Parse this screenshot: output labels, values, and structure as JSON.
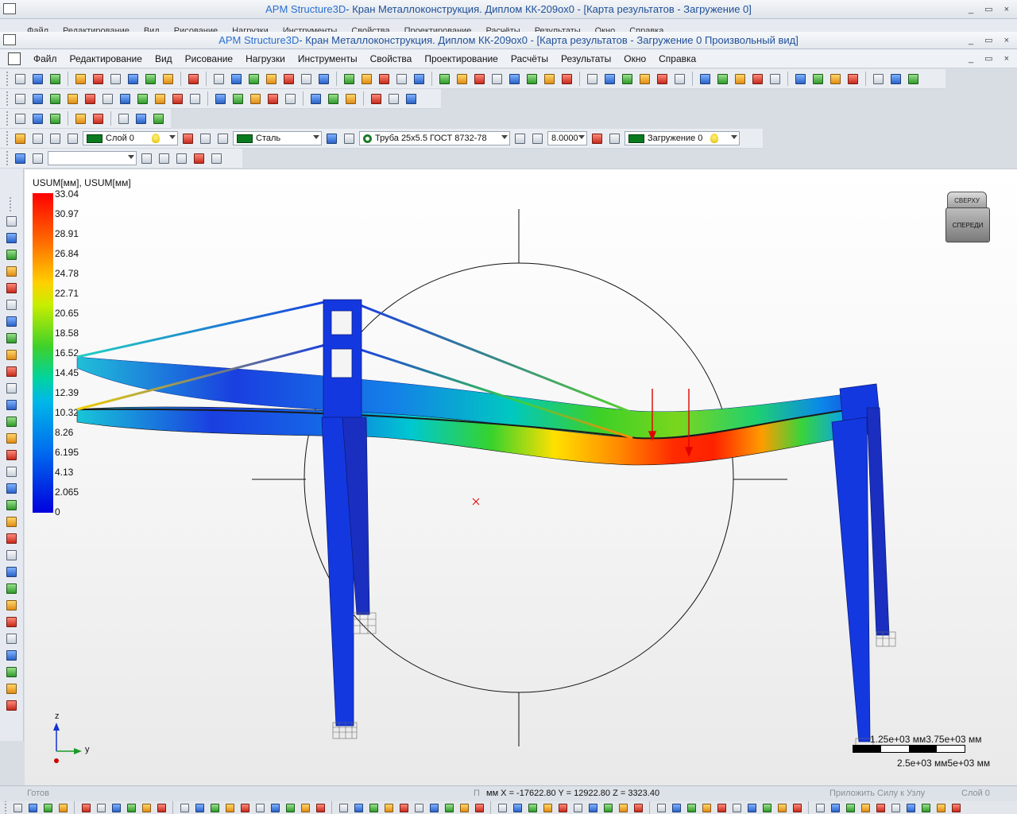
{
  "outer_window": {
    "app": "APM Structure3D",
    "title_rest": " - Кран Металлоконструкция. Диплом КК-209ох0 - [Карта результатов - Загружение 0]"
  },
  "inner_window": {
    "app": "APM Structure3D",
    "title_rest": " - Кран Металлоконструкция. Диплом КК-209ох0 - [Карта результатов - Загружение 0 Произвольный вид]"
  },
  "ghost_menu": [
    "Файл",
    "Редактирование",
    "Вид",
    "Рисование",
    "Нагрузки",
    "Инструменты",
    "Свойства",
    "Проектирование",
    "Расчёты",
    "Результаты",
    "Окно",
    "Справка"
  ],
  "menu": [
    "Файл",
    "Редактирование",
    "Вид",
    "Рисование",
    "Нагрузки",
    "Инструменты",
    "Свойства",
    "Проектирование",
    "Расчёты",
    "Результаты",
    "Окно",
    "Справка"
  ],
  "window_controls": {
    "minimize": "_",
    "restore": "▭",
    "close": "×"
  },
  "toolbar_props": {
    "layer": "Слой 0",
    "material": "Сталь",
    "section": "Труба  25x5.5 ГОСТ 8732-78",
    "angle": "8.0000",
    "load_case": "Загружение 0",
    "layer_color": "#0a7a1e"
  },
  "legend": {
    "title": "USUM[мм], USUM[мм]",
    "values": [
      "33.04",
      "30.97",
      "28.91",
      "26.84",
      "24.78",
      "22.71",
      "20.65",
      "18.58",
      "16.52",
      "14.45",
      "12.39",
      "10.32",
      "8.26",
      "6.195",
      "4.13",
      "2.065",
      "0"
    ]
  },
  "viewcube": {
    "top": "СВЕРХУ",
    "front": "СПЕРЕДИ"
  },
  "scale": {
    "top": "1.25e+03 мм3.75e+03 мм",
    "bottom": "2.5e+03 мм5e+03 мм"
  },
  "axes": {
    "z": "z",
    "y": "y"
  },
  "status": {
    "ready": "Готов",
    "units": "П",
    "coords": "мм  X = -17622.80 Y = 12922.80 Z = 3323.40",
    "hint": "Приложить Силу к Узлу",
    "layer": "Слой 0"
  },
  "colors": {
    "accent": "#2a6fd0",
    "deform_max": "#ff0000",
    "deform_min": "#0000dd",
    "load_arrow": "#e00000"
  }
}
